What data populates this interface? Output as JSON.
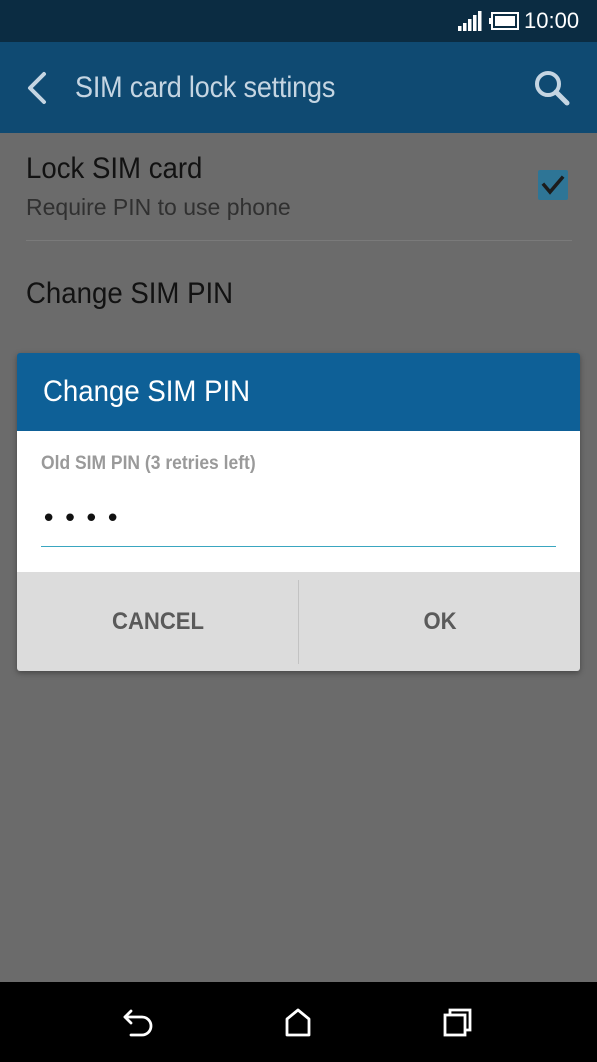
{
  "status_bar": {
    "time": "10:00",
    "icons": [
      "signal-icon",
      "battery-icon"
    ]
  },
  "app_bar": {
    "title": "SIM card lock settings",
    "icons": [
      "back-arrow-icon",
      "search-icon"
    ]
  },
  "settings": {
    "lock_sim": {
      "title": "Lock SIM card",
      "subtitle": "Require PIN to use phone",
      "checked": true
    },
    "change_pin": {
      "title": "Change SIM PIN"
    }
  },
  "dialog": {
    "title": "Change SIM PIN",
    "field_label": "Old SIM PIN (3 retries left)",
    "pin_value": "••••",
    "cancel_label": "CANCEL",
    "ok_label": "OK"
  },
  "nav_bar": {
    "icons": [
      "nav-back-icon",
      "nav-home-icon",
      "nav-recents-icon"
    ]
  },
  "colors": {
    "status_bar": "#0b2c42",
    "app_bar": "#0f4a72",
    "dialog_header": "#0e6097",
    "checkbox": "#2e7596",
    "input_underline": "#3aa6c0",
    "scrim_background": "#6b6b6b"
  }
}
